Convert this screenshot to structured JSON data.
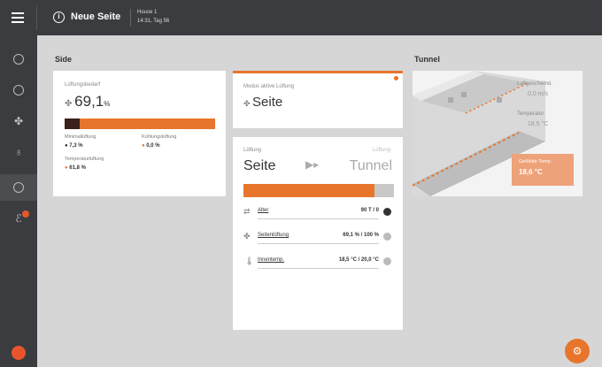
{
  "topbar": {
    "title": "Neue Seite",
    "sub1": "House 1",
    "sub2": "14:31, Tag 56"
  },
  "sections": {
    "side": "Side",
    "tunnel": "Tunnel"
  },
  "ventilation_need": {
    "label": "Lüftungsbedarf",
    "value": "69,1",
    "unit": "%",
    "level_fraction": 0.69,
    "minimum_label": "Minimallüftung",
    "minimum_value": "7,3 %",
    "cooling_label": "Kühlungslüftung",
    "cooling_value": "0,0 %",
    "temperature_label": "Temperaturlüftung",
    "temperature_value": "61,8 %"
  },
  "mode_card": {
    "label": "Modus aktive Lüftung",
    "value": "Seite"
  },
  "transition_card": {
    "left_caption": "Lüftung",
    "right_caption": "Lüftung",
    "from": "Seite",
    "to": "Tunnel",
    "progress_fraction": 0.87
  },
  "conditions": [
    {
      "icon": "clock-icon",
      "label": "Alter",
      "value": "90 T / 0",
      "status": "ok"
    },
    {
      "icon": "fan-icon",
      "label": "Seitenlüftung",
      "value": "69,1 % / 100 %",
      "status": "pending"
    },
    {
      "icon": "thermometer-icon",
      "label": "Innentemp.",
      "value": "18,5 °C / 20,0 °C",
      "status": "pending"
    }
  ],
  "tunnel_card": {
    "airspeed_label": "Luftgeschwind.",
    "airspeed_value": "0,0 m/s",
    "temp_label": "Temperatur",
    "temp_value": "18,5 °C",
    "felt_label": "Gefühlte Temp.",
    "felt_value": "18,6 °C"
  },
  "colors": {
    "accent": "#e8752c",
    "sidebar": "#3b3c3f",
    "dark_bar": "#3a1f1a"
  }
}
